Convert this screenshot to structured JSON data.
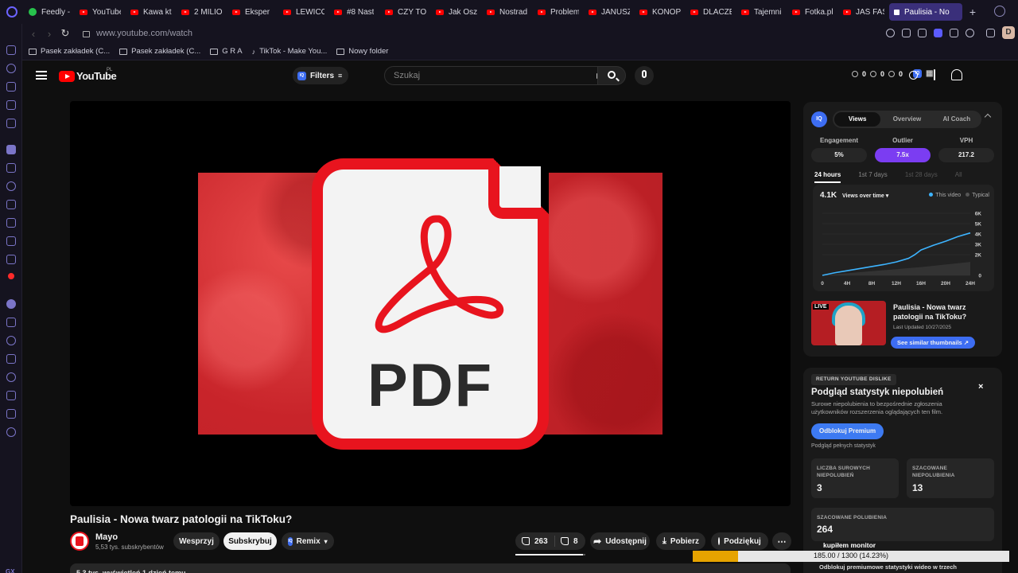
{
  "browser": {
    "tabs": [
      {
        "label": "Feedly -",
        "favicon": "feedly-icon",
        "width": 64
      },
      {
        "label": "YouTube",
        "favicon": "youtube-icon",
        "width": 64
      },
      {
        "label": "Kawa kt",
        "favicon": "youtube-icon",
        "width": 64
      },
      {
        "label": "2 MILIO",
        "favicon": "youtube-icon",
        "width": 64
      },
      {
        "label": "Eksper",
        "favicon": "youtube-icon",
        "width": 64
      },
      {
        "label": "LEWICO",
        "favicon": "youtube-icon",
        "width": 64
      },
      {
        "label": "#8 Nast",
        "favicon": "youtube-icon",
        "width": 64
      },
      {
        "label": "CZY TO",
        "favicon": "youtube-icon",
        "width": 64
      },
      {
        "label": "Jak Osz",
        "favicon": "youtube-icon",
        "width": 64
      },
      {
        "label": "Nostrad",
        "favicon": "youtube-icon",
        "width": 64
      },
      {
        "label": "Problem",
        "favicon": "youtube-icon",
        "width": 64
      },
      {
        "label": "JANUSZ",
        "favicon": "youtube-icon",
        "width": 64
      },
      {
        "label": "KONOP",
        "favicon": "youtube-icon",
        "width": 64
      },
      {
        "label": "DLACZE",
        "favicon": "youtube-icon",
        "width": 64
      },
      {
        "label": "Tajemni",
        "favicon": "youtube-icon",
        "width": 64
      },
      {
        "label": "Fotka.pl",
        "favicon": "youtube-icon",
        "width": 64
      },
      {
        "label": "JAŚ FAS",
        "favicon": "youtube-icon",
        "width": 64
      },
      {
        "label": "Paulisia - No",
        "favicon": "speaker-icon",
        "width": 92,
        "active": true
      }
    ],
    "url": "www.youtube.com/watch",
    "profile_initial": "D",
    "bookmarks": [
      {
        "label": "Pasek zakładek (C...",
        "icon": "folder-icon"
      },
      {
        "label": "Pasek zakładek (C...",
        "icon": "folder-icon"
      },
      {
        "label": "G R A",
        "icon": "folder-icon"
      },
      {
        "label": "TikTok - Make You...",
        "icon": "tiktok-icon"
      },
      {
        "label": "Nowy folder",
        "icon": "folder-icon"
      }
    ],
    "sidebar_badge": "GX"
  },
  "youtube": {
    "logo_text": "YouTube",
    "country": "PL",
    "filters_label": "Filters",
    "search_placeholder": "Szukaj",
    "masthead_stats": [
      "0",
      "0",
      "0"
    ],
    "video": {
      "thumbnail_text": "PDF",
      "title": "Paulisia - Nowa twarz patologii na TikToku?",
      "channel_name": "Mayo",
      "channel_subs": "5,53 tys. subskrybentów",
      "join_label": "Wesprzyj",
      "subscribe_label": "Subskrybuj",
      "remix_label": "Remix",
      "likes": "263",
      "dislikes": "8",
      "like_ratio": 0.97,
      "share_label": "Udostępnij",
      "download_label": "Pobierz",
      "thanks_label": "Podziękuj",
      "description_peek": "5,3 tys. wyświetleń  1 dzień temu"
    }
  },
  "vidiq": {
    "logo": "IQ",
    "tabs": [
      "Views",
      "Overview",
      "AI Coach"
    ],
    "active_tab": "Views",
    "stats": [
      {
        "label": "Engagement",
        "value": "5%"
      },
      {
        "label": "Outlier",
        "value": "7.5x",
        "highlight": true
      },
      {
        "label": "VPH",
        "value": "217.2"
      }
    ],
    "ranges": [
      "24 hours",
      "1st 7 days",
      "1st 28 days",
      "All"
    ],
    "total_views": "4.1K",
    "metric_label": "Views over time",
    "legend": [
      {
        "label": "This video",
        "color": "#3db4ff"
      },
      {
        "label": "Typical",
        "color": "#555555"
      }
    ],
    "similar": {
      "title": "Paulisia - Nowa twarz patologii na TikToku?",
      "updated": "Last Updated 10/27/2025",
      "button": "See similar thumbnails",
      "thumb_text": "LIVE"
    }
  },
  "chart_data": {
    "type": "line",
    "title": "Views over time",
    "x": [
      0,
      4,
      8,
      12,
      16,
      20,
      24
    ],
    "xticks": [
      "0",
      "4H",
      "8H",
      "12H",
      "16H",
      "20H",
      "24H"
    ],
    "yticks": [
      "6K",
      "5K",
      "4K",
      "3K",
      "2K",
      "0"
    ],
    "ylim": [
      0,
      6000
    ],
    "series": [
      {
        "name": "This video",
        "color": "#3db4ff",
        "x": [
          0,
          2,
          4,
          6,
          8,
          10,
          12,
          14,
          15,
          16,
          18,
          20,
          22,
          24
        ],
        "values": [
          0,
          250,
          450,
          650,
          850,
          1050,
          1300,
          1650,
          2000,
          2450,
          2900,
          3300,
          3750,
          4100
        ]
      },
      {
        "name": "Typical",
        "color": "#555555",
        "x": [
          0,
          4,
          8,
          12,
          16,
          20,
          24
        ],
        "values": [
          0,
          200,
          400,
          600,
          800,
          1050,
          1300
        ]
      }
    ]
  },
  "ryd": {
    "badge": "RETURN YOUTUBE DISLIKE",
    "title": "Podgląd statystyk niepolubień",
    "description": "Surowe niepolubienia to bezpośrednie zgłoszenia użytkowników rozszerzenia oglądających ten film.",
    "unlock_label": "Odblokuj Premium",
    "preview_label": "Podgląd pełnych statystyk",
    "boxes": [
      {
        "label": "LICZBA SUROWYCH NIEPOLUBIEŃ",
        "value": "3"
      },
      {
        "label": "SZACOWANE NIEPOLUBIENIA",
        "value": "13"
      },
      {
        "label": "SZACOWANE POLUBIENIA",
        "value": "264"
      }
    ],
    "overlay_label": "kupiłem monitor",
    "footer": "Odblokuj premiumowe statystyki wideo w trzech"
  },
  "progress": {
    "text": "185.00 / 1300 (14.23%)",
    "fraction": 0.1423,
    "color": "#e6a300"
  }
}
